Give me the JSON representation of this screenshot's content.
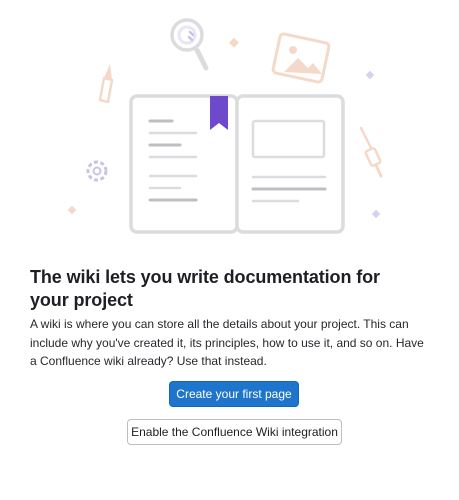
{
  "empty_state": {
    "illustration": {
      "icons": [
        "magnifier-icon",
        "image-frame-icon",
        "pencil-icon",
        "gear-icon",
        "brush-icon",
        "sparkle-icon",
        "open-book-icon",
        "bookmark-icon"
      ],
      "colors": {
        "book_outline": "#dcdcde",
        "book_lines": "#bfbfc3",
        "bookmark": "#6e49cb",
        "accent_orange": "#f5d9c8",
        "accent_purple": "#d9d0f0",
        "magnifier": "#c9c3e6"
      }
    },
    "title": "The wiki lets you write documentation for your project",
    "description": "A wiki is where you can store all the details about your project. This can include why you've created it, its principles, how to use it, and so on. Have a Confluence wiki already? Use that instead.",
    "primary_button_label": "Create your first page",
    "secondary_button_label": "Enable the Confluence Wiki integration",
    "colors": {
      "primary_button_bg": "#1f75cb",
      "secondary_button_border": "#bfbfc3",
      "text": "#1f1e24"
    }
  }
}
